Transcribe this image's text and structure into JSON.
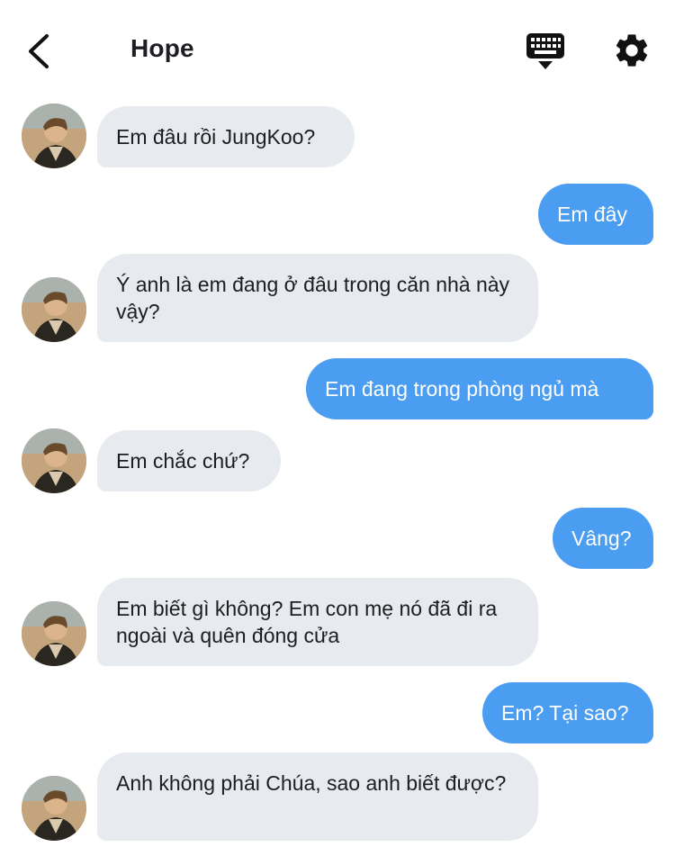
{
  "header": {
    "title": "Hope",
    "back_icon": "chevron-left-icon",
    "keyboard_icon": "keyboard-icon",
    "settings_icon": "gear-icon"
  },
  "colors": {
    "incoming_bubble": "#e7eaee",
    "outgoing_bubble": "#4a9df0",
    "text": "#1c1e21"
  },
  "messages": [
    {
      "sender": "Hope",
      "text": "Em đâu rồi JungKoo?"
    },
    {
      "sender": "me",
      "text": "Em đây"
    },
    {
      "sender": "Hope",
      "text": "Ý anh là em đang ở đâu trong căn nhà này vậy?"
    },
    {
      "sender": "me",
      "text": "Em đang trong phòng ngủ mà"
    },
    {
      "sender": "Hope",
      "text": "Em chắc chứ?"
    },
    {
      "sender": "me",
      "text": "Vâng?"
    },
    {
      "sender": "Hope",
      "text": "Em biết gì không? Em con mẹ nó đã đi ra ngoài và quên đóng cửa"
    },
    {
      "sender": "me",
      "text": "Em? Tại sao?"
    },
    {
      "sender": "Hope",
      "text": "Anh không phải Chúa, sao anh biết được?"
    }
  ]
}
